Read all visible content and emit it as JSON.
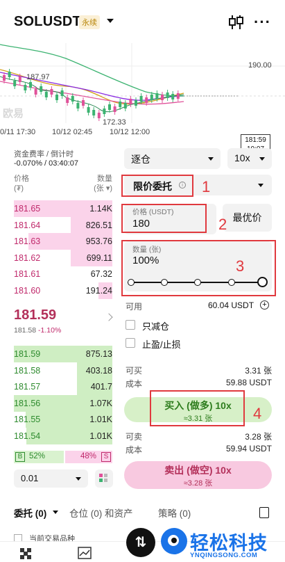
{
  "header": {
    "symbol": "SOLUSDT",
    "contract_tag": "永续",
    "icons": [
      "candlestick-settings-icon",
      "more-icon"
    ]
  },
  "chart": {
    "price_labels": [
      "190.00",
      "187.97",
      "172.33"
    ],
    "current_price_box": [
      "181:59",
      "10:07"
    ],
    "time_labels": [
      "0/11 17:30",
      "10/12 02:45",
      "10/12 12:00"
    ],
    "watermark": "欧易",
    "colors": {
      "up": "#3cb371",
      "down": "#e0529a",
      "ma1": "#d4a017",
      "ma2": "#8a2be2",
      "ma3": "#2e8b57"
    }
  },
  "funding": {
    "label": "资金费率 / 倒计时",
    "value": "-0.070% / 03:40:07"
  },
  "order_book": {
    "price_header": [
      "价格",
      "(₮)"
    ],
    "qty_header": [
      "数量",
      "(张 ▾)"
    ],
    "asks": [
      {
        "price": "181.65",
        "qty": "1.14K",
        "depth": 1.0
      },
      {
        "price": "181.64",
        "qty": "826.51",
        "depth": 0.42
      },
      {
        "price": "181.63",
        "qty": "953.76",
        "depth": 0.85
      },
      {
        "price": "181.62",
        "qty": "699.11",
        "depth": 0.42
      },
      {
        "price": "181.61",
        "qty": "67.32",
        "depth": 0.0
      },
      {
        "price": "181.60",
        "qty": "191.24",
        "depth": 0.14
      }
    ],
    "last_price": "181.59",
    "mark_price": "181.58",
    "change": "-1.10%",
    "bids": [
      {
        "price": "181.59",
        "qty": "875.13",
        "depth": 1.0
      },
      {
        "price": "181.58",
        "qty": "403.18",
        "depth": 0.36
      },
      {
        "price": "181.57",
        "qty": "401.7",
        "depth": 0.36
      },
      {
        "price": "181.56",
        "qty": "1.07K",
        "depth": 1.0
      },
      {
        "price": "181.55",
        "qty": "1.01K",
        "depth": 0.88
      },
      {
        "price": "181.54",
        "qty": "1.01K",
        "depth": 0.87
      }
    ],
    "buy_ratio": "52%",
    "sell_ratio": "48%",
    "buy_tag": "B",
    "sell_tag": "S",
    "depth_step": "0.01"
  },
  "order_form": {
    "margin_mode": "逐仓",
    "leverage": "10x",
    "order_type": "限价委托",
    "price_label": "价格 (USDT)",
    "price_value": "180",
    "best_price_button": "最优价",
    "qty_label": "数量 (张)",
    "qty_value": "100%",
    "slider_level": 1.0,
    "available_label": "可用",
    "available_value": "60.04 USDT",
    "reduce_only": "只减仓",
    "tp_sl": "止盈/止损",
    "can_buy_label": "可买",
    "can_buy_value": "3.31 张",
    "cost_label": "成本",
    "buy_cost_value": "59.88 USDT",
    "buy_button": "买入 (做多) 10x",
    "buy_sub": "≈3.31 张",
    "can_sell_label": "可卖",
    "can_sell_value": "3.28 张",
    "sell_cost_value": "59.94 USDT",
    "sell_button": "卖出 (做空) 10x",
    "sell_sub": "≈3.28 张"
  },
  "annotations": [
    "1",
    "2",
    "3",
    "4"
  ],
  "tabs": {
    "orders": "委托 (0)",
    "positions": "仓位 (0) 和资产",
    "strategy": "策略 (0)",
    "filter": "当前交易品种"
  },
  "brand": {
    "name": "轻松科技",
    "url": "YNQINGSONG.COM"
  }
}
